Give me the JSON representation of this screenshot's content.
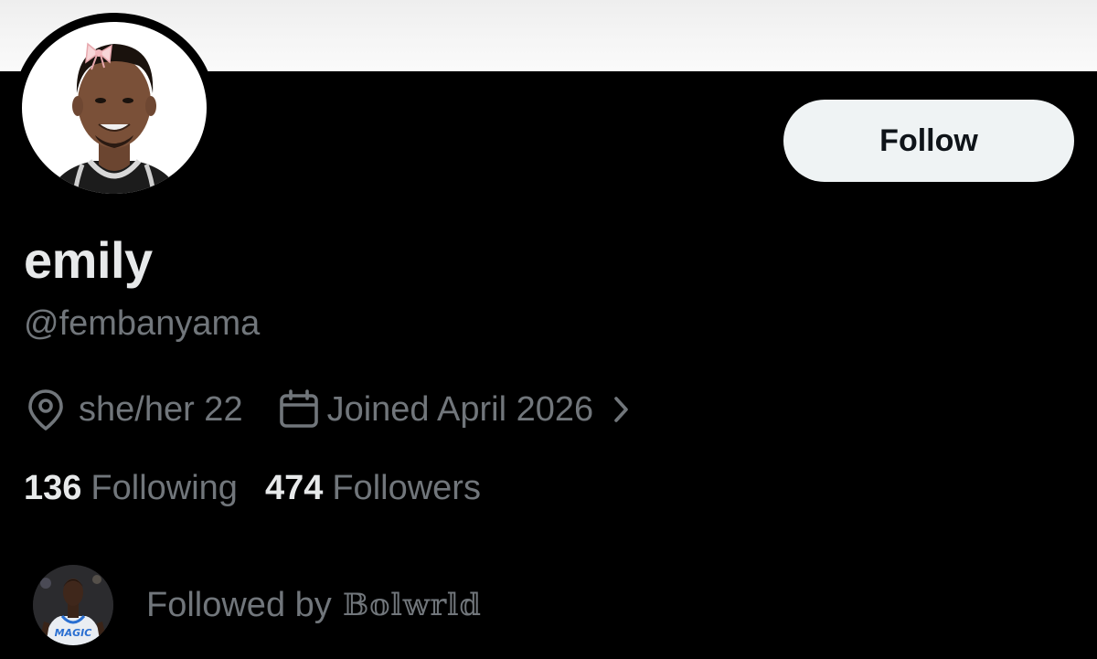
{
  "profile": {
    "display_name": "emily",
    "handle": "@fembanyama",
    "location": "she/her 22",
    "joined": "Joined April 2026",
    "following_count": "136",
    "following_label": "Following",
    "followers_count": "474",
    "followers_label": "Followers"
  },
  "actions": {
    "follow_label": "Follow"
  },
  "followed_by": {
    "prefix": "Followed by",
    "name": "𝔹𝕠𝕝𝕨𝕣𝕝𝕕"
  },
  "icons": {
    "location": "location-pin-icon",
    "calendar": "calendar-icon",
    "chevron": "chevron-right-icon"
  },
  "colors": {
    "background": "#000000",
    "primary_text": "#e7e9ea",
    "secondary_text": "#71767b",
    "follow_button_bg": "#eff3f4",
    "follow_button_text": "#0f1419",
    "banner": "#f2f2f2"
  }
}
